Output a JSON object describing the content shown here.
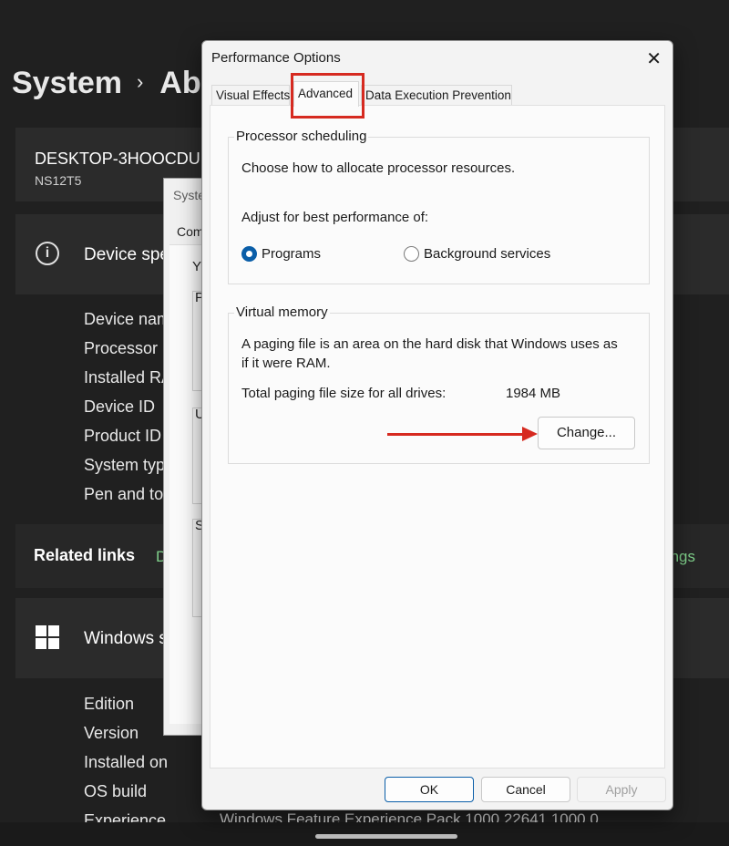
{
  "settings": {
    "breadcrumb_parent": "System",
    "breadcrumb_sep": "›",
    "breadcrumb_current": "Ab",
    "device_name": "DESKTOP-3HOOCDU",
    "device_sub": "NS12T5",
    "device_specs_title": "Device spe",
    "device_spec_labels": [
      "Device nam",
      "Processor",
      "Installed RA",
      "Device ID",
      "Product ID",
      "System typ",
      "Pen and to"
    ],
    "related_links_title": "Related links",
    "related_link_left": "D",
    "related_link_right": "ngs",
    "windows_specs_title": "Windows s",
    "windows_spec_labels": [
      "Edition",
      "Version",
      "Installed on",
      "OS build",
      "Experience"
    ],
    "experience_value": "Windows Feature Experience Pack 1000.22641.1000.0"
  },
  "system_properties": {
    "title": "Syste",
    "tab": "Com",
    "fragments": [
      "Y",
      "P",
      "U",
      "S"
    ]
  },
  "dialog": {
    "title": "Performance Options",
    "close_glyph": "✕",
    "tabs": [
      "Visual Effects",
      "Advanced",
      "Data Execution Prevention"
    ],
    "processor_scheduling": {
      "label": "Processor scheduling",
      "description": "Choose how to allocate processor resources.",
      "adjust_label": "Adjust for best performance of:",
      "options": [
        "Programs",
        "Background services"
      ],
      "selected": "Programs"
    },
    "virtual_memory": {
      "label": "Virtual memory",
      "description_line1": "A paging file is an area on the hard disk that Windows uses as",
      "description_line2": "if it were RAM.",
      "total_label": "Total paging file size for all drives:",
      "total_value": "1984 MB",
      "change_button": "Change..."
    },
    "buttons": {
      "ok": "OK",
      "cancel": "Cancel",
      "apply": "Apply"
    }
  },
  "colors": {
    "highlight": "#d62a20",
    "accent": "#0a5ea8",
    "link_green": "#7fd08a"
  }
}
